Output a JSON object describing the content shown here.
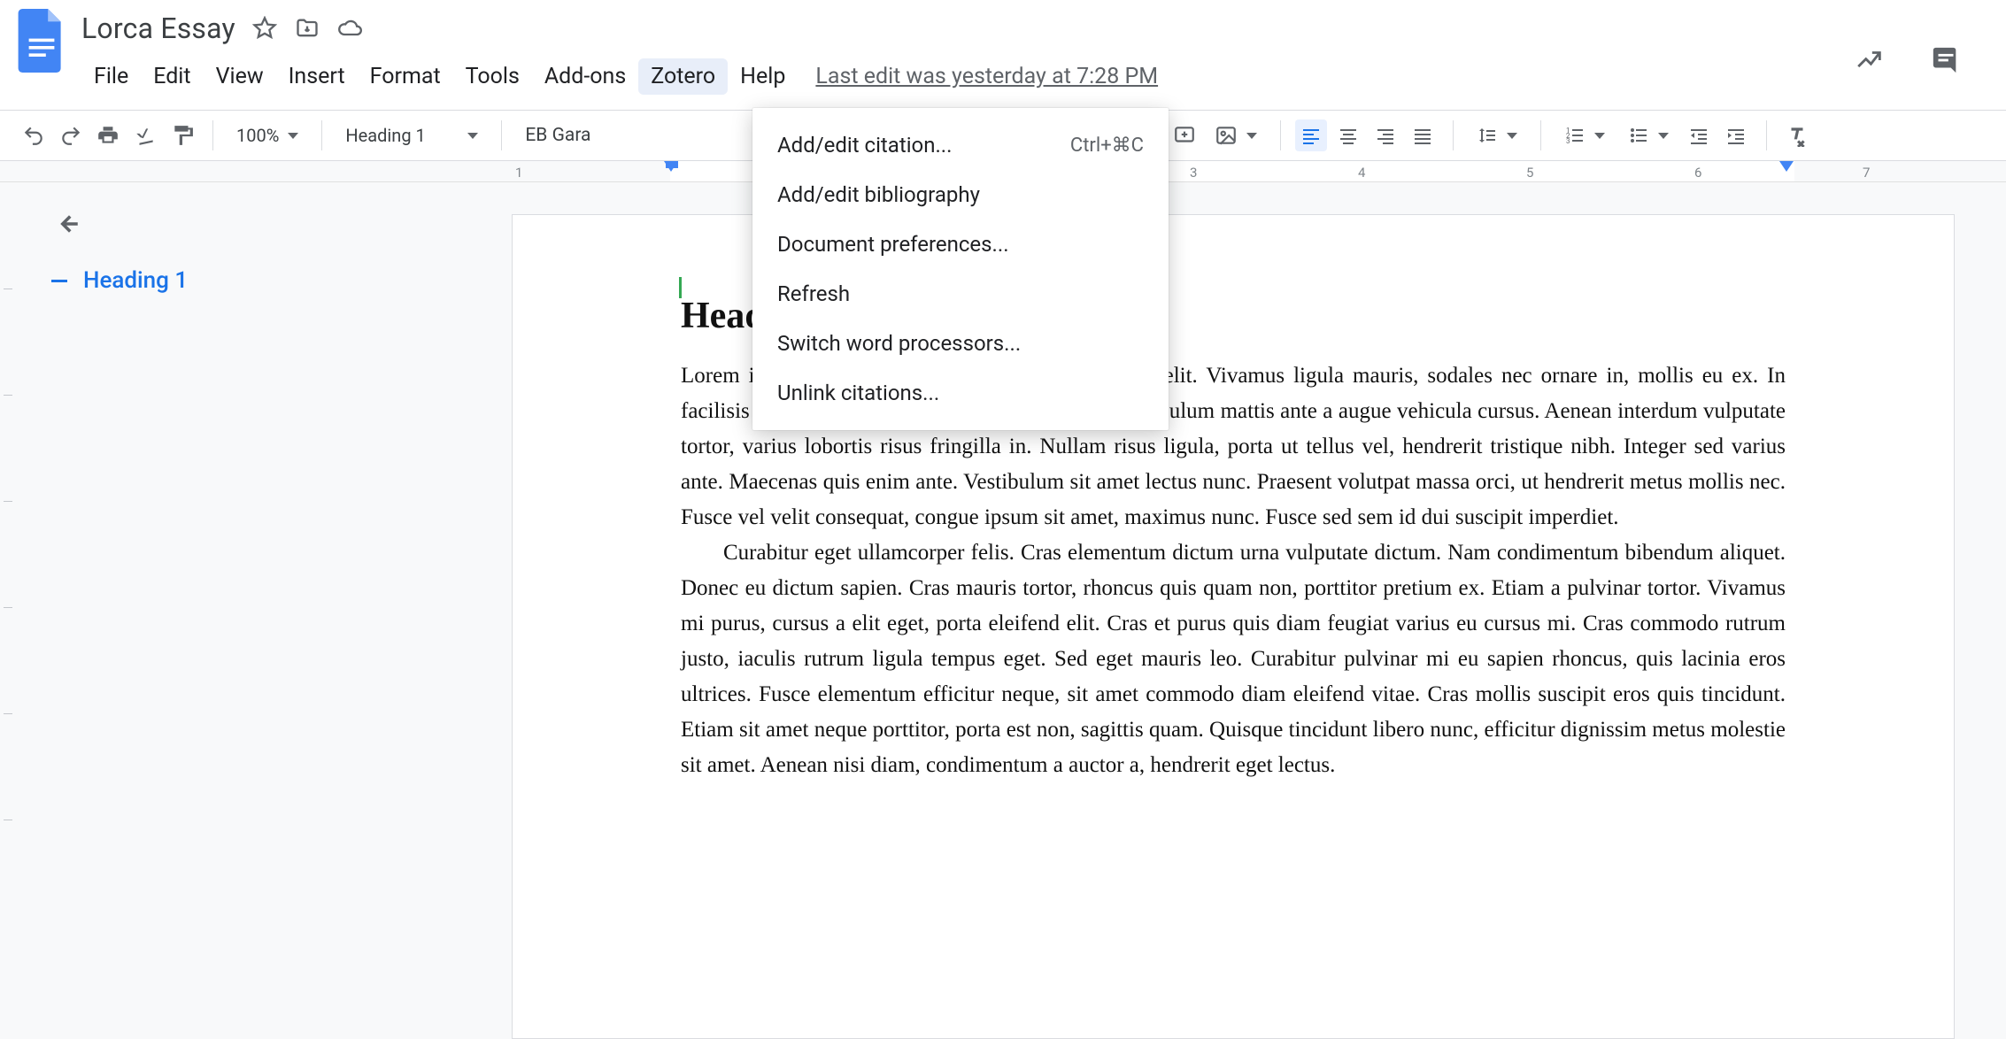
{
  "doc": {
    "title": "Lorca Essay",
    "last_edit": "Last edit was yesterday at 7:28 PM"
  },
  "menu": {
    "items": [
      "File",
      "Edit",
      "View",
      "Insert",
      "Format",
      "Tools",
      "Add-ons",
      "Zotero",
      "Help"
    ],
    "active_index": 7
  },
  "toolbar": {
    "zoom": "100%",
    "style": "Heading 1",
    "font": "EB Gara"
  },
  "ruler": {
    "labels": [
      "1",
      "3",
      "4",
      "5",
      "6",
      "7"
    ]
  },
  "dropdown": {
    "items": [
      {
        "label": "Add/edit citation...",
        "shortcut": "Ctrl+⌘C"
      },
      {
        "label": "Add/edit bibliography",
        "shortcut": ""
      },
      {
        "label": "Document preferences...",
        "shortcut": ""
      },
      {
        "label": "Refresh",
        "shortcut": ""
      },
      {
        "label": "Switch word processors...",
        "shortcut": ""
      },
      {
        "label": "Unlink citations...",
        "shortcut": ""
      }
    ]
  },
  "outline": {
    "heading": "Heading 1"
  },
  "content": {
    "heading": "Heading",
    "p1": "Lorem ipsum dolor sit amet, consectetur adipiscing elit. Vivamus ligula mauris, sodales nec ornare in, mollis eu ex. In facilisis euismod faucibus. Sed ut massa magna. Vestibulum mattis ante a augue vehicula cursus. Aenean interdum vulputate tortor, varius lobortis risus fringilla in. Nullam risus ligula, porta ut tellus vel, hendrerit tristique nibh. Integer sed varius ante. Maecenas quis enim ante. Vestibulum sit amet lectus nunc. Praesent volutpat massa orci, ut hendrerit metus mollis nec. Fusce vel velit consequat, congue ipsum sit amet, maximus nunc. Fusce sed sem id dui suscipit imperdiet.",
    "p2": "Curabitur eget ullamcorper felis. Cras elementum dictum urna vulputate dictum. Nam condimentum bibendum aliquet. Donec eu dictum sapien. Cras mauris tortor, rhoncus quis quam non, porttitor pretium ex. Etiam a pulvinar tortor. Vivamus mi purus, cursus a elit eget, porta eleifend elit. Cras et purus quis diam feugiat varius eu cursus mi. Cras commodo rutrum justo, iaculis rutrum ligula tempus eget. Sed eget mauris leo. Curabitur pulvinar mi eu sapien rhoncus, quis lacinia eros ultrices. Fusce elementum efficitur neque, sit amet commodo diam eleifend vitae. Cras mollis suscipit eros quis tincidunt. Etiam sit amet neque porttitor, porta est non, sagittis quam. Quisque tincidunt libero nunc, efficitur dignissim metus molestie sit amet. Aenean nisi diam, condimentum a auctor a, hendrerit eget lectus."
  }
}
